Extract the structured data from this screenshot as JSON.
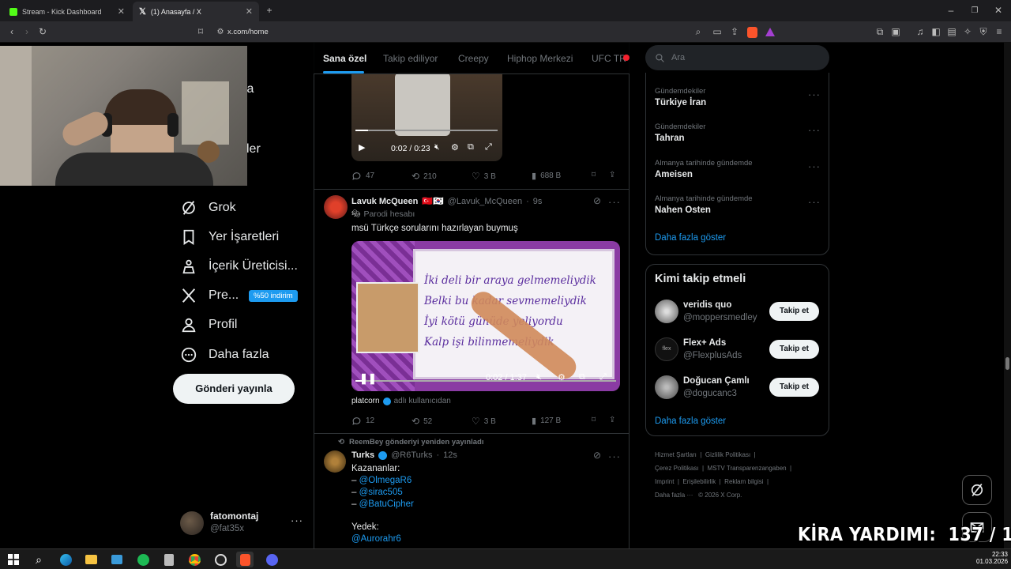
{
  "browser": {
    "tabs": [
      {
        "title": "Stream - Kick Dashboard",
        "active": false
      },
      {
        "title": "(1) Anasayfa / X",
        "active": true
      }
    ],
    "url": "x.com/home"
  },
  "left_nav": {
    "hidden_partial_1": "yfa",
    "hidden_partial_2": "ler",
    "items": [
      {
        "label": "Grok",
        "icon": "grok-icon"
      },
      {
        "label": "Yer İşaretleri",
        "icon": "bookmark-icon"
      },
      {
        "label": "İçerik Üreticisi...",
        "icon": "creator-icon"
      },
      {
        "label": "Pre...",
        "icon": "x-logo-icon"
      },
      {
        "label": "Profil",
        "icon": "profile-icon"
      },
      {
        "label": "Daha fazla",
        "icon": "more-circle-icon"
      }
    ],
    "premium_badge": "%50 indirim",
    "post_button": "Gönderi yayınla",
    "account": {
      "name": "fatomontaj",
      "handle": "@fat35x"
    }
  },
  "feed_tabs": [
    "Sana özel",
    "Takip ediliyor",
    "Creepy",
    "Hiphop Merkezi",
    "UFC TR"
  ],
  "posts": [
    {
      "video_time": "0:02 / 0:23",
      "stats": {
        "replies": "47",
        "reposts": "210",
        "likes": "3 B",
        "views": "688 B"
      }
    },
    {
      "author": "Lavuk McQueen",
      "flags": "🇹🇷🇰🇷",
      "handle": "@Lavuk_McQueen",
      "time": "9s",
      "label": "Parodi hesabı",
      "text": "msü Türkçe sorularını hazırlayan buymuş",
      "board_lines": [
        "İki deli bir araya gelmemeliydik",
        "Belki bu kadar sevmemeliydik",
        "İyi kötü günüde yeliyordu",
        "Kalp işi bilinmemeliydik"
      ],
      "video_time": "0:02 / 1:37",
      "source": "platcorn",
      "source_suffix": "adlı kullanıcıdan",
      "stats": {
        "replies": "12",
        "reposts": "52",
        "likes": "3 B",
        "views": "127 B"
      }
    },
    {
      "repost_note": "ReemBey gönderiyi yeniden yayınladı",
      "author": "Turks",
      "handle": "@R6Turks",
      "time": "12s",
      "lines": [
        "Kazananlar:"
      ],
      "links": [
        "@OlmegaR6",
        "@sirac505",
        "@BatuCipher"
      ],
      "line_dash": "– ",
      "reserve_label": "Yedek:",
      "reserve_link": "@Aurorahr6"
    }
  ],
  "right": {
    "search_placeholder": "Ara",
    "trends": [
      {
        "meta": "Gündemdekiler",
        "name": "Türkiye İran"
      },
      {
        "meta": "Gündemdekiler",
        "name": "Tahran"
      },
      {
        "meta": "Almanya tarihinde gündemde",
        "name": "Ameisen"
      },
      {
        "meta": "Almanya tarihinde gündemde",
        "name": "Nahen Osten"
      }
    ],
    "show_more": "Daha fazla göster",
    "who_to_follow_title": "Kimi takip etmeli",
    "suggestions": [
      {
        "name": "veridis quo",
        "handle": "@moppersmedley"
      },
      {
        "name": "Flex+ Ads",
        "handle": "@FlexplusAds"
      },
      {
        "name": "Doğucan Çamlı",
        "handle": "@dogucanc3"
      }
    ],
    "follow_label": "Takip et",
    "footer": [
      "Hizmet Şartları",
      "Gizlilik Politikası",
      "Çerez Politikası",
      "MSTV Transparenzangaben",
      "Imprint",
      "Erişilebilirlik",
      "Reklam bilgisi",
      "Daha fazla ···",
      "© 2026 X Corp."
    ]
  },
  "overlay": {
    "text": "KİRA YARDIMI:  137 / 140"
  },
  "taskbar": {
    "time": "22:33",
    "date": "01.03.2026"
  },
  "colors": {
    "accent": "#1d9bf0",
    "background": "#000000",
    "border": "#2f3336"
  }
}
